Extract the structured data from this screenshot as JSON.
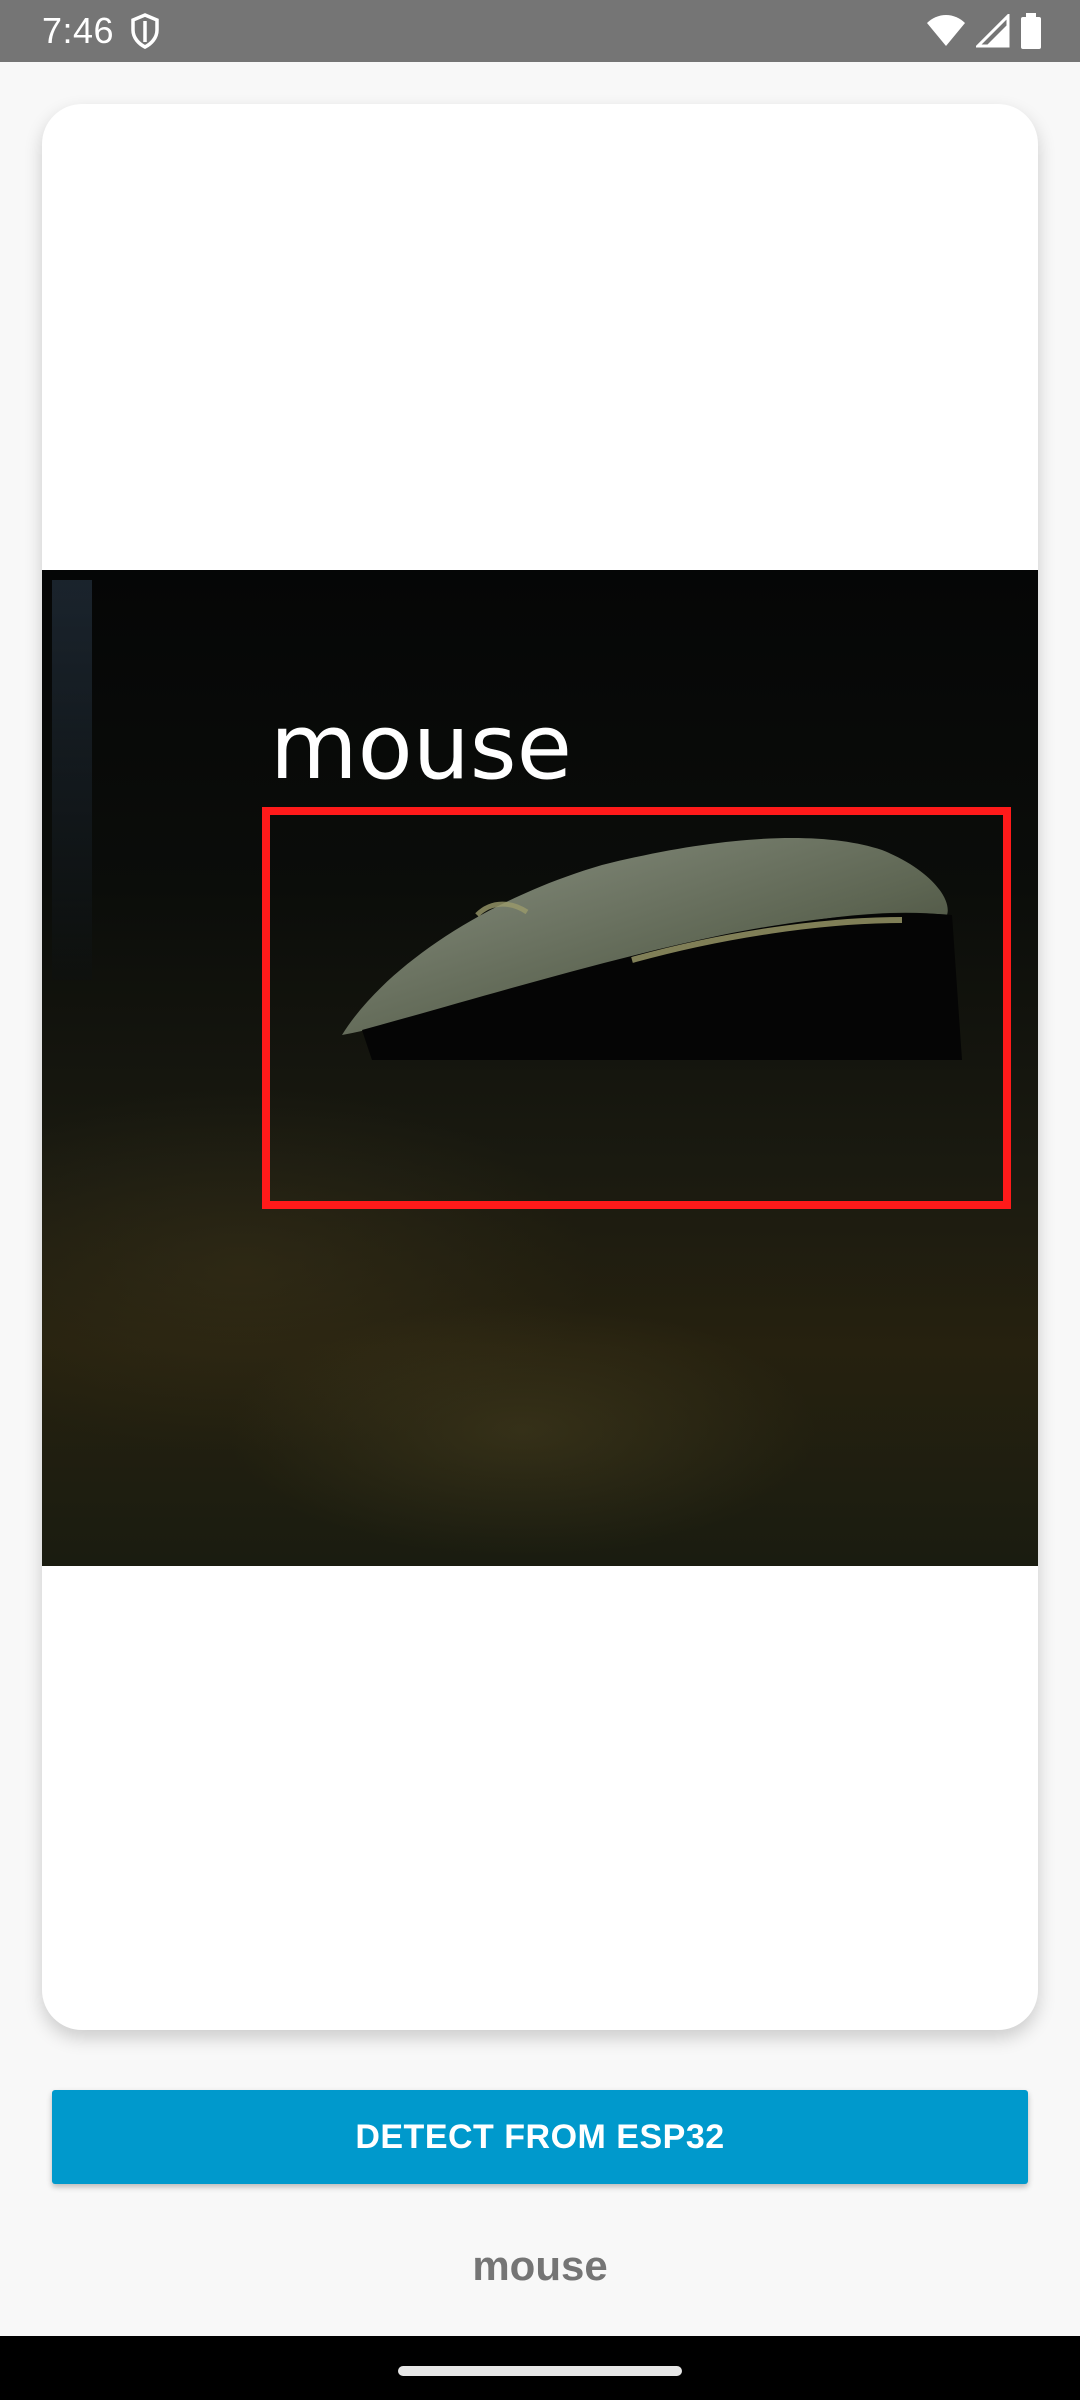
{
  "status_bar": {
    "time": "7:46",
    "icons": [
      "shield-icon",
      "wifi-icon",
      "cellular-signal-icon",
      "battery-icon"
    ]
  },
  "camera": {
    "detection_label": "mouse",
    "bbox_color": "#ff1a1a"
  },
  "actions": {
    "detect_button_label": "DETECT FROM ESP32",
    "button_color": "#0099cc"
  },
  "result": {
    "text": "mouse"
  }
}
